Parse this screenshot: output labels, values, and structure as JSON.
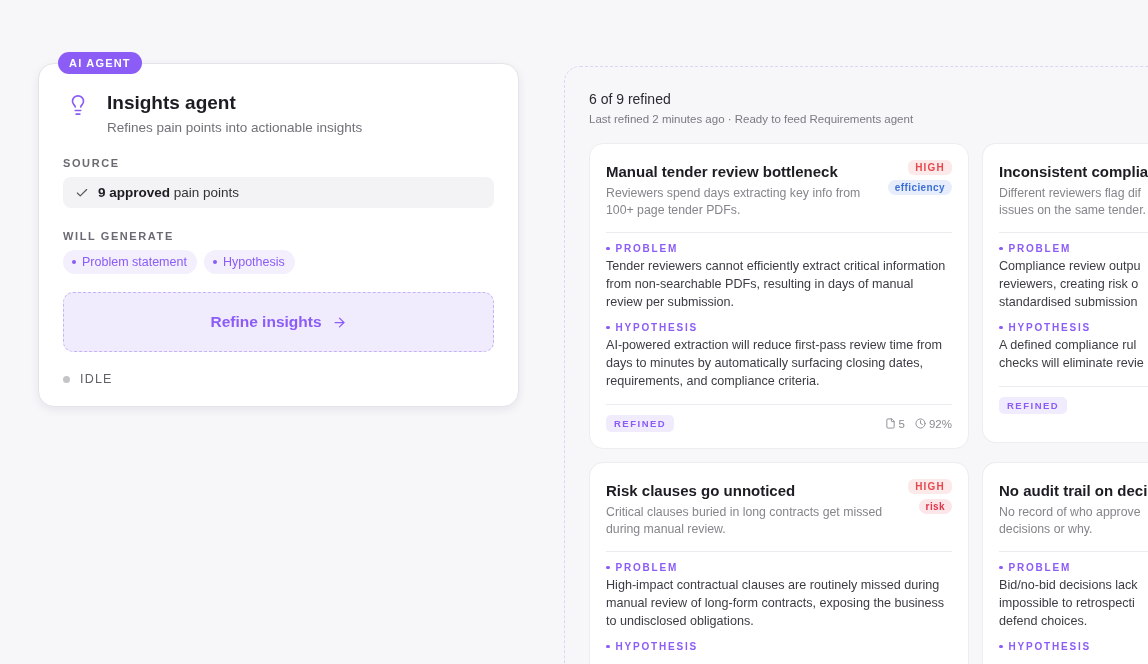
{
  "agent": {
    "badge": "AI AGENT",
    "title": "Insights agent",
    "subtitle": "Refines pain points into actionable insights",
    "source_label": "SOURCE",
    "source": "**9 approved** pain points",
    "generate_label": "WILL GENERATE",
    "outputs": [
      "Problem statement",
      "Hypothesis"
    ],
    "action": "Refine insights",
    "status": "IDLE"
  },
  "results": {
    "count": "6 of 9 refined",
    "meta": "Last refined 2 minutes ago · Ready to feed Requirements agent",
    "cards": [
      {
        "kind": "full",
        "title": "Manual tender review bottleneck",
        "summary": "Reviewers spend days extracting key info from 100+ page tender PDFs.",
        "tags": [
          {
            "label": "HIGH",
            "color": "#e5484d",
            "kind": "priority"
          },
          {
            "label": "efficiency",
            "color": "#3b6fd8",
            "kind": "category"
          }
        ],
        "problem_label": "PROBLEM",
        "problem": "Tender reviewers cannot efficiently extract critical information from non-searchable PDFs, resulting in days of manual review per submission.",
        "hypothesis_label": "HYPOTHESIS",
        "hypothesis": "AI-powered extraction will reduce first-pass review time from days to minutes by automatically surfacing closing dates, requirements, and compliance criteria.",
        "status": "REFINED",
        "sources": "5",
        "confidence": "92%"
      },
      {
        "kind": "clipped",
        "title": "Inconsistent complia",
        "summary": "Different reviewers flag dif\nissues on the same tender.",
        "problem_label": "PROBLEM",
        "problem": "Compliance review outpu\nreviewers, creating risk o\nstandardised submission",
        "hypothesis_label": "HYPOTHESIS",
        "hypothesis": "A defined compliance rul\nchecks will eliminate revie",
        "status": "REFINED"
      },
      {
        "kind": "full",
        "title": "Risk clauses go unnoticed",
        "summary": "Critical clauses buried in long contracts get missed during manual review.",
        "tags": [
          {
            "label": "HIGH",
            "color": "#e5484d",
            "kind": "priority"
          },
          {
            "label": "risk",
            "color": "#e0354a",
            "kind": "category"
          }
        ],
        "problem_label": "PROBLEM",
        "problem": "High-impact contractual clauses are routinely missed during manual review of long-form contracts, exposing the business to undisclosed obligations.",
        "hypothesis_label": "HYPOTHESIS"
      },
      {
        "kind": "clipped",
        "title": "No audit trail on deci",
        "summary": "No record of who approve\ndecisions or why.",
        "problem_label": "PROBLEM",
        "problem": "Bid/no-bid decisions lack\nimpossible to retrospecti\ndefend choices.",
        "hypothesis_label": "HYPOTHESIS"
      }
    ]
  }
}
